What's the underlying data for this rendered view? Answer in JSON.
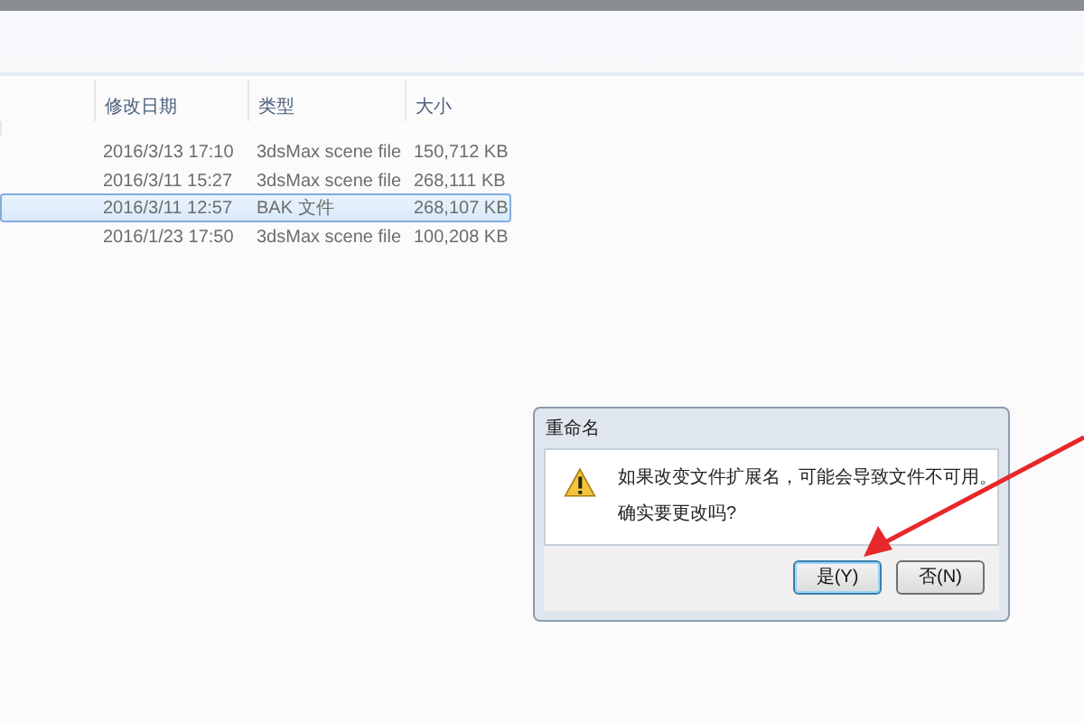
{
  "file_list": {
    "columns": [
      "修改日期",
      "类型",
      "大小"
    ],
    "rows": [
      {
        "modified": "2016/3/13 17:10",
        "type": "3dsMax scene file",
        "size": "150,712 KB",
        "selected": false
      },
      {
        "modified": "2016/3/11 15:27",
        "type": "3dsMax scene file",
        "size": "268,111 KB",
        "selected": false
      },
      {
        "modified": "2016/3/11 12:57",
        "type": "BAK 文件",
        "size": "268,107 KB",
        "selected": true
      },
      {
        "modified": "2016/1/23 17:50",
        "type": "3dsMax scene file",
        "size": "100,208 KB",
        "selected": false
      }
    ]
  },
  "dialog": {
    "title": "重命名",
    "message": "如果改变文件扩展名，可能会导致文件不可用。",
    "question": "确实要更改吗?",
    "buttons": [
      {
        "label": "是(Y)",
        "default": true
      },
      {
        "label": "否(N)",
        "default": false
      }
    ]
  }
}
